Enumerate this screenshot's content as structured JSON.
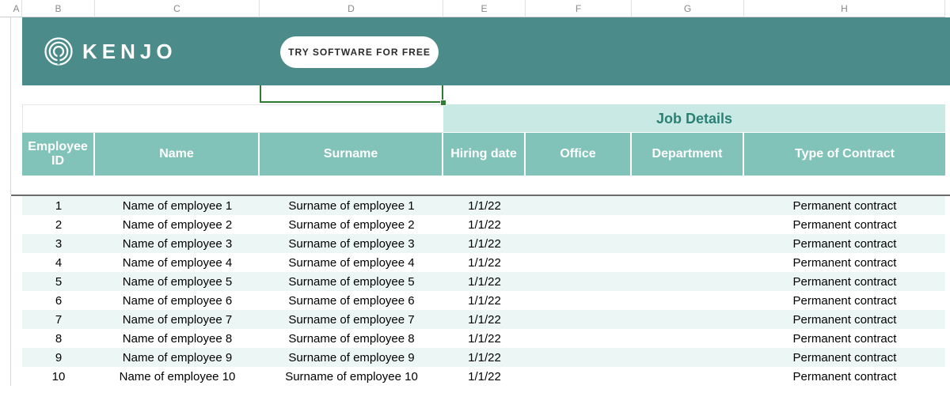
{
  "columns": {
    "A": "A",
    "B": "B",
    "C": "C",
    "D": "D",
    "E": "E",
    "F": "F",
    "G": "G",
    "H": "H"
  },
  "banner": {
    "brand": "KENJO",
    "cta_label": "TRY SOFTWARE FOR FREE"
  },
  "section": {
    "job_details": "Job Details"
  },
  "headers": {
    "employee_id": "Employee ID",
    "name": "Name",
    "surname": "Surname",
    "hiring_date": "Hiring date",
    "office": "Office",
    "department": "Department",
    "type_of_contract": "Type of Contract"
  },
  "rows": [
    {
      "id": "1",
      "name": "Name of employee 1",
      "surname": "Surname of employee 1",
      "hiring_date": "1/1/22",
      "office": "",
      "department": "",
      "contract": "Permanent contract"
    },
    {
      "id": "2",
      "name": "Name of employee 2",
      "surname": "Surname of employee 2",
      "hiring_date": "1/1/22",
      "office": "",
      "department": "",
      "contract": "Permanent contract"
    },
    {
      "id": "3",
      "name": "Name of employee 3",
      "surname": "Surname of employee 3",
      "hiring_date": "1/1/22",
      "office": "",
      "department": "",
      "contract": "Permanent contract"
    },
    {
      "id": "4",
      "name": "Name of employee 4",
      "surname": "Surname of employee 4",
      "hiring_date": "1/1/22",
      "office": "",
      "department": "",
      "contract": "Permanent contract"
    },
    {
      "id": "5",
      "name": "Name of employee 5",
      "surname": "Surname of employee 5",
      "hiring_date": "1/1/22",
      "office": "",
      "department": "",
      "contract": "Permanent contract"
    },
    {
      "id": "6",
      "name": "Name of employee 6",
      "surname": "Surname of employee 6",
      "hiring_date": "1/1/22",
      "office": "",
      "department": "",
      "contract": "Permanent contract"
    },
    {
      "id": "7",
      "name": "Name of employee 7",
      "surname": "Surname of employee 7",
      "hiring_date": "1/1/22",
      "office": "",
      "department": "",
      "contract": "Permanent contract"
    },
    {
      "id": "8",
      "name": "Name of employee 8",
      "surname": "Surname of employee 8",
      "hiring_date": "1/1/22",
      "office": "",
      "department": "",
      "contract": "Permanent contract"
    },
    {
      "id": "9",
      "name": "Name of employee 9",
      "surname": "Surname of employee 9",
      "hiring_date": "1/1/22",
      "office": "",
      "department": "",
      "contract": "Permanent contract"
    },
    {
      "id": "10",
      "name": "Name of employee 10",
      "surname": "Surname of employee 10",
      "hiring_date": "1/1/22",
      "office": "",
      "department": "",
      "contract": "Permanent contract"
    }
  ]
}
